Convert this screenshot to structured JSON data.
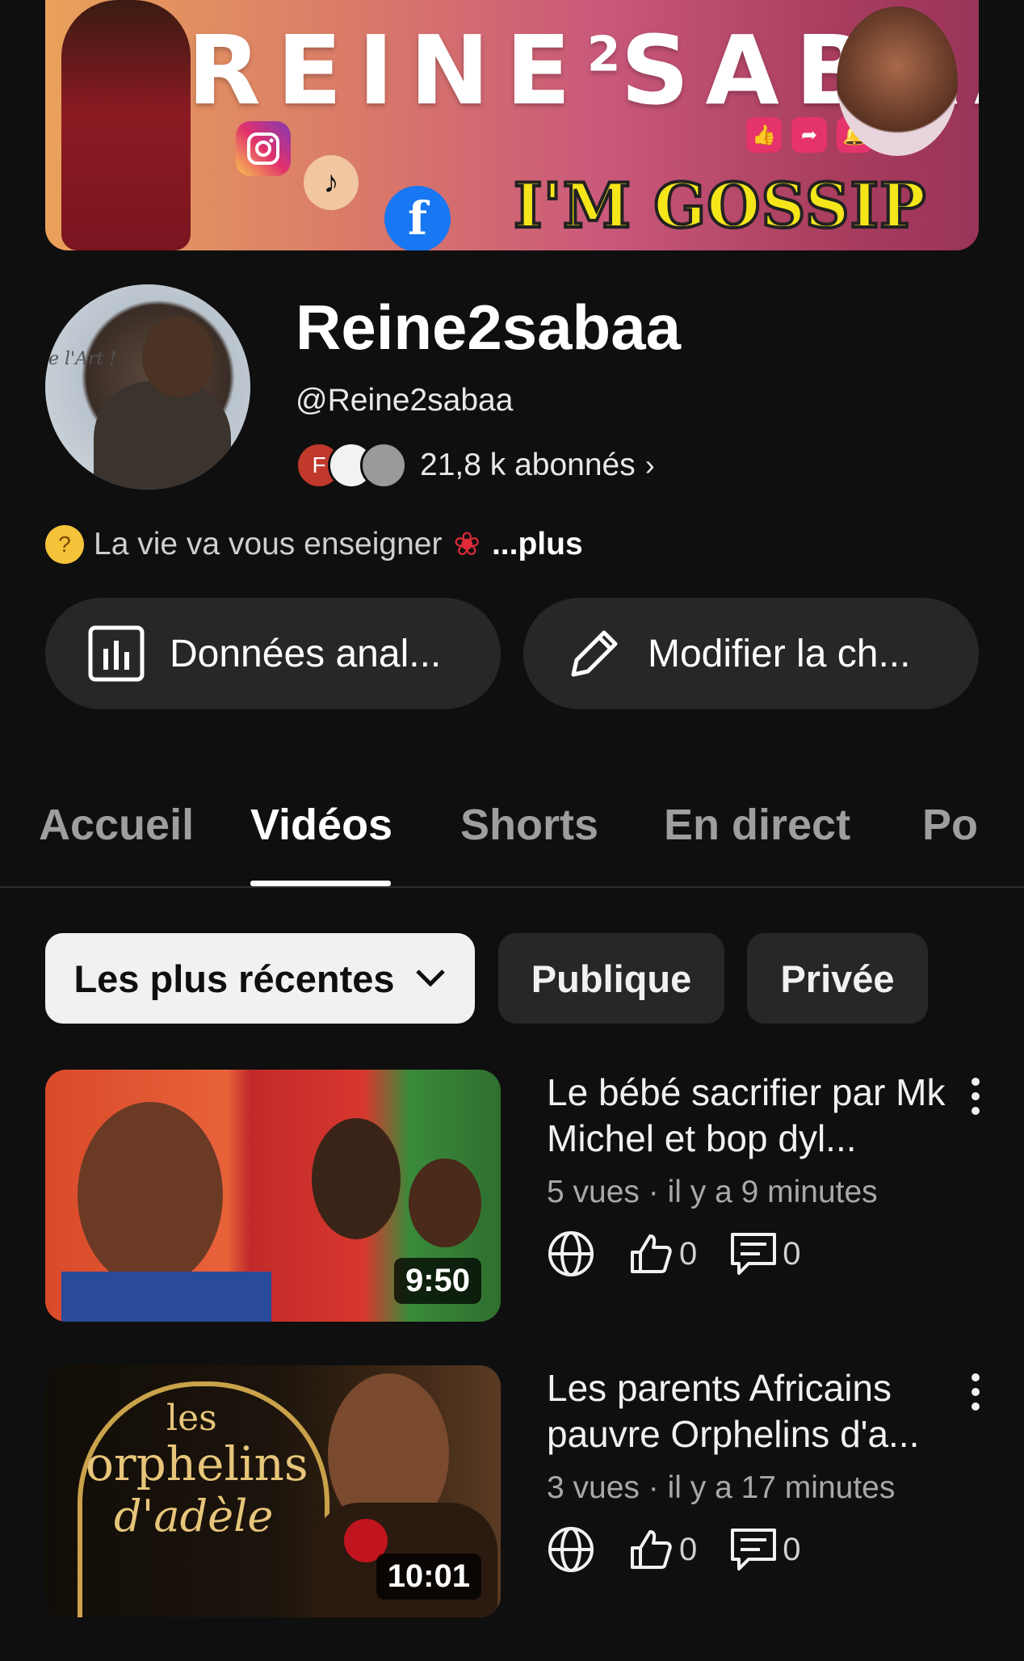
{
  "banner": {
    "title_main": "REINE",
    "title_sup": "2",
    "title_end": "SABAA",
    "tagline": "I'M GOSSIP GIRL",
    "icons": [
      "instagram-icon",
      "tiktok-icon",
      "facebook-icon",
      "like-icon",
      "share-icon",
      "bell-icon"
    ]
  },
  "channel": {
    "name": "Reine2sabaa",
    "handle": "@Reine2sabaa",
    "subscriber_avatar_letter": "F",
    "subscribers": "21,8 k abonnés",
    "subscribers_chevron": "›",
    "avatar_text": "e l'Art !",
    "description": "La vie va vous enseigner",
    "description_more": "...plus"
  },
  "actions": {
    "analytics_label": "Données anal...",
    "edit_label": "Modifier la ch..."
  },
  "tabs": [
    {
      "label": "Accueil",
      "active": false
    },
    {
      "label": "Vidéos",
      "active": true
    },
    {
      "label": "Shorts",
      "active": false
    },
    {
      "label": "En direct",
      "active": false
    },
    {
      "label": "Po",
      "active": false
    }
  ],
  "filters": {
    "sort_label": "Les plus récentes",
    "public_label": "Publique",
    "private_label": "Privée"
  },
  "videos": [
    {
      "title": "Le bébé sacrifier par Mk Michel et bop dyl...",
      "meta": "5 vues · il y a 9 minutes",
      "duration": "9:50",
      "likes": "0",
      "comments": "0"
    },
    {
      "title": "Les parents Africains pauvre Orphelins d'a...",
      "meta": "3 vues · il y a 17 minutes",
      "duration": "10:01",
      "likes": "0",
      "comments": "0",
      "thumb_text_1": "les",
      "thumb_text_2": "orphelins",
      "thumb_text_3": "d'adèle"
    }
  ],
  "colors": {
    "background": "#0f0f0f",
    "surface": "#272727",
    "text_primary": "#f1f1f1",
    "text_secondary": "#a8a8a8",
    "chip_active": "#f1f1f1"
  }
}
